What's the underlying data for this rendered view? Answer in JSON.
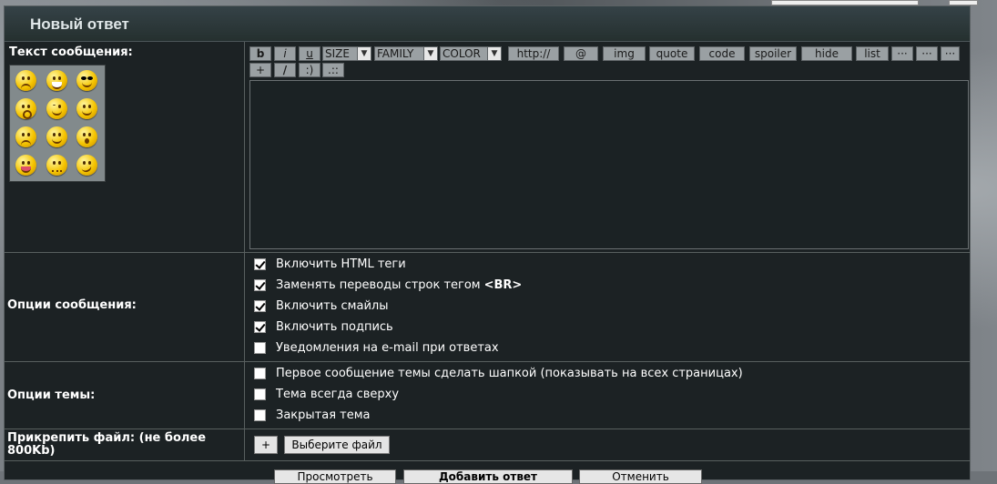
{
  "header": {
    "title": "Новый ответ"
  },
  "message": {
    "label": "Текст сообщения:",
    "text": ""
  },
  "toolbar": {
    "bold": "b",
    "italic": "i",
    "underline": "u",
    "size": "SIZE",
    "family": "FAMILY",
    "color": "COLOR",
    "url": "http://",
    "email": "@",
    "img": "img",
    "quote": "quote",
    "code": "code",
    "spoiler": "spoiler",
    "hide": "hide",
    "list": "list",
    "more1": "···",
    "more2": "···",
    "more3": "···",
    "plus": "+",
    "slash": "/",
    "smile": ":)",
    "dots": ".::"
  },
  "post_options": {
    "label": "Опции сообщения:",
    "items": [
      {
        "label": "Включить HTML теги",
        "checked": true
      },
      {
        "label": "Заменять переводы строк тегом ",
        "label_bold": "<BR>",
        "checked": true
      },
      {
        "label": "Включить смайлы",
        "checked": true
      },
      {
        "label": "Включить подпись",
        "checked": true
      },
      {
        "label": "Уведомления на e-mail при ответах",
        "checked": false
      }
    ]
  },
  "topic_options": {
    "label": "Опции темы:",
    "items": [
      {
        "label": "Первое сообщение темы сделать шапкой (показывать на всех страницах)",
        "checked": false
      },
      {
        "label": "Тема всегда сверху",
        "checked": false
      },
      {
        "label": "Закрытая тема",
        "checked": false
      }
    ]
  },
  "attach": {
    "label": "Прикрепить файл: (не более 800Kb)",
    "add_label": "+",
    "choose_label": "Выберите файл"
  },
  "bottom_buttons": {
    "preview": "Просмотреть",
    "submit": "Добавить ответ",
    "cancel": "Отменить"
  }
}
